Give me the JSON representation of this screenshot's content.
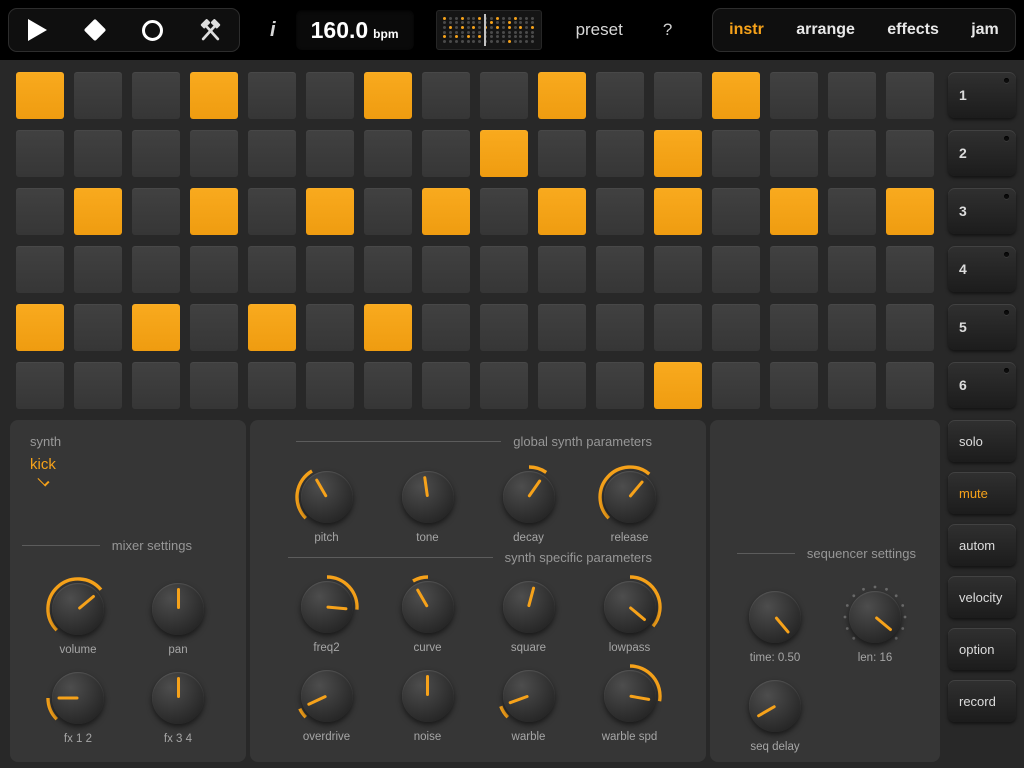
{
  "colors": {
    "accent": "#f6a21a",
    "topbar_bg": "#000000",
    "panel_bg": "#363636",
    "page_bg": "#282828"
  },
  "topbar": {
    "transport_icons": [
      "play-icon",
      "diamond-icon",
      "circle-icon",
      "hammers-icon"
    ],
    "info_label": "i",
    "bpm_value": "160.0",
    "bpm_unit": "bpm",
    "preset_label": "preset",
    "help_label": "?",
    "minimap": {
      "cursor_col": 7
    },
    "tabs": [
      {
        "label": "instr",
        "active": true
      },
      {
        "label": "arrange",
        "active": false
      },
      {
        "label": "effects",
        "active": false
      },
      {
        "label": "jam",
        "active": false
      }
    ]
  },
  "grid": {
    "rows": 6,
    "cols": 16,
    "active": [
      [
        0,
        0
      ],
      [
        0,
        3
      ],
      [
        0,
        6
      ],
      [
        0,
        9
      ],
      [
        0,
        12
      ],
      [
        1,
        8
      ],
      [
        1,
        11
      ],
      [
        2,
        1
      ],
      [
        2,
        3
      ],
      [
        2,
        5
      ],
      [
        2,
        7
      ],
      [
        2,
        9
      ],
      [
        2,
        11
      ],
      [
        2,
        13
      ],
      [
        2,
        15
      ],
      [
        4,
        0
      ],
      [
        4,
        2
      ],
      [
        4,
        4
      ],
      [
        4,
        6
      ],
      [
        5,
        11
      ]
    ]
  },
  "sidebar": {
    "tracks": [
      "1",
      "2",
      "3",
      "4",
      "5",
      "6"
    ],
    "buttons": [
      {
        "label": "solo",
        "accent": false,
        "gap_before": false
      },
      {
        "label": "mute",
        "accent": true,
        "gap_before": false
      },
      {
        "label": "autom",
        "accent": false,
        "gap_before": true
      },
      {
        "label": "velocity",
        "accent": false,
        "gap_before": false
      },
      {
        "label": "option",
        "accent": false,
        "gap_before": true
      },
      {
        "label": "record",
        "accent": false,
        "gap_before": false
      }
    ]
  },
  "left_panel": {
    "synth_label": "synth",
    "synth_value": "kick",
    "section_title": "mixer settings",
    "knobs": [
      {
        "label": "volume",
        "value": 50,
        "arc": [
          -135,
          50
        ]
      },
      {
        "label": "pan",
        "value": 0,
        "arc": null
      },
      {
        "label": "fx 1 2",
        "value": -90,
        "arc": [
          -135,
          -90
        ]
      },
      {
        "label": "fx 3 4",
        "value": 0,
        "arc": null
      }
    ]
  },
  "middle_panel": {
    "sections": [
      {
        "title": "global synth parameters",
        "knobs": [
          {
            "label": "pitch",
            "value": -30,
            "arc": [
              -135,
              -30
            ]
          },
          {
            "label": "tone",
            "value": -8,
            "arc": null
          },
          {
            "label": "decay",
            "value": 35,
            "arc": [
              0,
              35
            ]
          },
          {
            "label": "release",
            "value": 40,
            "arc": [
              -135,
              40
            ]
          }
        ]
      },
      {
        "title": "synth specific parameters",
        "knobs": [
          {
            "label": "freq2",
            "value": 95,
            "arc": [
              0,
              95
            ]
          },
          {
            "label": "curve",
            "value": -30,
            "arc": [
              0,
              -30
            ]
          },
          {
            "label": "square",
            "value": 15,
            "arc": null
          },
          {
            "label": "lowpass",
            "value": 130,
            "arc": [
              0,
              130
            ]
          },
          {
            "label": "overdrive",
            "value": -115,
            "arc": [
              -135,
              -115
            ]
          },
          {
            "label": "noise",
            "value": 0,
            "arc": null
          },
          {
            "label": "warble",
            "value": -110,
            "arc": [
              -135,
              -110
            ]
          },
          {
            "label": "warble spd",
            "value": 100,
            "arc": [
              0,
              100
            ]
          }
        ]
      }
    ]
  },
  "right_panel": {
    "title": "sequencer settings",
    "knobs": [
      {
        "label": "time: 0.50",
        "value": 140,
        "arc": null
      },
      {
        "label": "len: 16",
        "value": 130,
        "arc": null,
        "ticks": true
      },
      {
        "label": "seq delay",
        "value": -120,
        "arc": null
      }
    ]
  }
}
